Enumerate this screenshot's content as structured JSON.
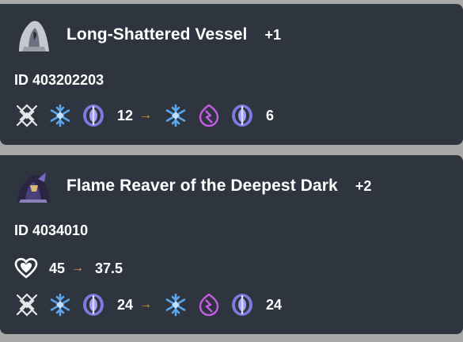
{
  "cards": [
    {
      "name": "Long-Shattered Vessel",
      "tier": "+1",
      "id": "ID 403202203",
      "weakness": {
        "from_value": "12",
        "arrow": "→",
        "to_value": "6"
      }
    },
    {
      "name": "Flame Reaver of the Deepest Dark",
      "tier": "+2",
      "id": "ID 4034010",
      "hp": {
        "from_value": "45",
        "arrow": "→",
        "to_value": "37.5"
      },
      "weakness": {
        "from_value": "24",
        "arrow": "→",
        "to_value": "24"
      }
    }
  ],
  "icons": {
    "physical": "physical-element-icon",
    "ice": "ice-element-icon",
    "imaginary": "imaginary-element-icon",
    "lightning": "lightning-element-icon",
    "heart": "heart-icon"
  },
  "colors": {
    "card_bg": "#2e353e",
    "page_bg": "#a8a8a8",
    "arrow": "#e8a02e",
    "ice": "#5aa7ee",
    "imaginary": "#7f79e0",
    "lightning": "#c65be6"
  }
}
